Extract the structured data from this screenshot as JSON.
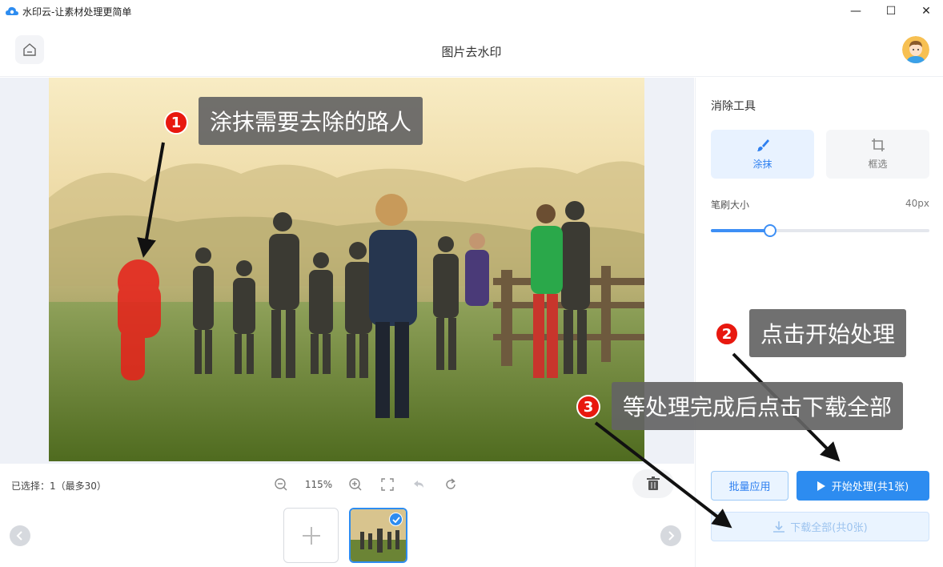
{
  "app": {
    "title": "水印云-让素材处理更简单",
    "window_controls": {
      "minimize": "—",
      "maximize": "☐",
      "close": "✕"
    }
  },
  "header": {
    "page_title": "图片去水印",
    "home_icon": "home-icon",
    "avatar_icon": "user-avatar"
  },
  "toolbar": {
    "selected_text": "已选择：1（最多30）",
    "zoom": "115%",
    "icons": [
      "zoom-out-icon",
      "zoom-in-icon",
      "fullscreen-icon",
      "undo-icon",
      "reset-icon",
      "trash-icon"
    ]
  },
  "panel": {
    "title": "消除工具",
    "tools": [
      {
        "label": "涂抹",
        "icon": "brush-icon",
        "active": true
      },
      {
        "label": "框选",
        "icon": "crop-icon",
        "active": false
      }
    ],
    "brush_label": "笔刷大小",
    "brush_value": "40px",
    "brush_level": 0.27,
    "batch_label": "批量应用",
    "start_label": "开始处理(共1张)",
    "download_label": "下载全部(共0张)"
  },
  "callouts": [
    {
      "num": "1",
      "text": "涂抹需要去除的路人"
    },
    {
      "num": "2",
      "text": "点击开始处理"
    },
    {
      "num": "3",
      "text": "等处理完成后点击下载全部"
    }
  ],
  "colors": {
    "accent": "#2d8cf0",
    "badge": "#e8180f",
    "mask": "#e8201a"
  }
}
